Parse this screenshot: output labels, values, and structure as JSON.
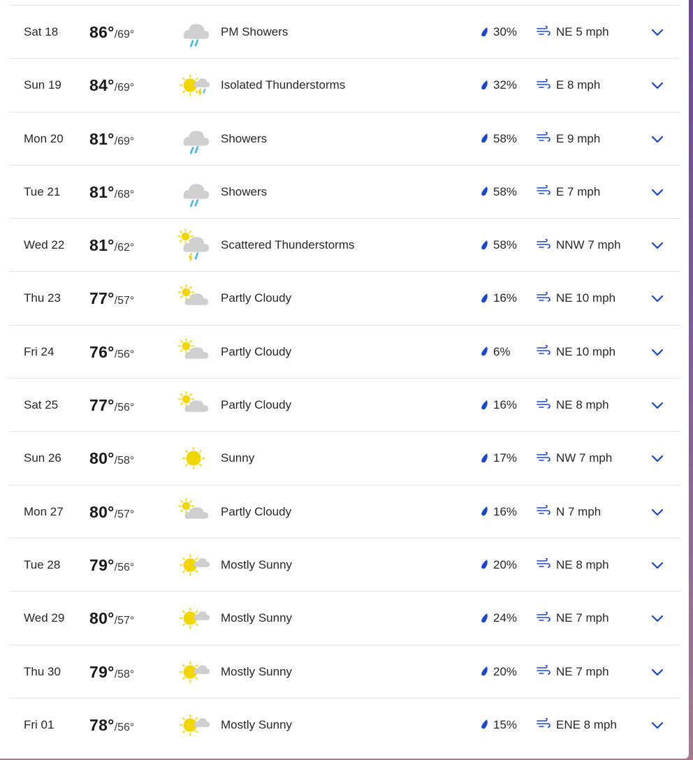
{
  "forecast": [
    {
      "day": "Sat 18",
      "high": "86°",
      "low": "/69°",
      "icon": "showers-icon",
      "condition": "PM Showers",
      "precip": "30%",
      "wind": "NE 5 mph"
    },
    {
      "day": "Sun 19",
      "high": "84°",
      "low": "/69°",
      "icon": "sun-thunder-icon",
      "condition": "Isolated Thunderstorms",
      "precip": "32%",
      "wind": "E 8 mph"
    },
    {
      "day": "Mon 20",
      "high": "81°",
      "low": "/69°",
      "icon": "showers-icon",
      "condition": "Showers",
      "precip": "58%",
      "wind": "E 9 mph"
    },
    {
      "day": "Tue 21",
      "high": "81°",
      "low": "/68°",
      "icon": "showers-icon",
      "condition": "Showers",
      "precip": "58%",
      "wind": "E 7 mph"
    },
    {
      "day": "Wed 22",
      "high": "81°",
      "low": "/62°",
      "icon": "scattered-thunderstorms-icon",
      "condition": "Scattered Thunderstorms",
      "precip": "58%",
      "wind": "NNW 7 mph"
    },
    {
      "day": "Thu 23",
      "high": "77°",
      "low": "/57°",
      "icon": "partly-cloudy-icon",
      "condition": "Partly Cloudy",
      "precip": "16%",
      "wind": "NE 10 mph"
    },
    {
      "day": "Fri 24",
      "high": "76°",
      "low": "/56°",
      "icon": "partly-cloudy-icon",
      "condition": "Partly Cloudy",
      "precip": "6%",
      "wind": "NE 10 mph"
    },
    {
      "day": "Sat 25",
      "high": "77°",
      "low": "/56°",
      "icon": "partly-cloudy-icon",
      "condition": "Partly Cloudy",
      "precip": "16%",
      "wind": "NE 8 mph"
    },
    {
      "day": "Sun 26",
      "high": "80°",
      "low": "/58°",
      "icon": "sunny-icon",
      "condition": "Sunny",
      "precip": "17%",
      "wind": "NW 7 mph"
    },
    {
      "day": "Mon 27",
      "high": "80°",
      "low": "/57°",
      "icon": "partly-cloudy-icon",
      "condition": "Partly Cloudy",
      "precip": "16%",
      "wind": "N 7 mph"
    },
    {
      "day": "Tue 28",
      "high": "79°",
      "low": "/56°",
      "icon": "mostly-sunny-icon",
      "condition": "Mostly Sunny",
      "precip": "20%",
      "wind": "NE 8 mph"
    },
    {
      "day": "Wed 29",
      "high": "80°",
      "low": "/57°",
      "icon": "mostly-sunny-icon",
      "condition": "Mostly Sunny",
      "precip": "24%",
      "wind": "NE 7 mph"
    },
    {
      "day": "Thu 30",
      "high": "79°",
      "low": "/58°",
      "icon": "mostly-sunny-icon",
      "condition": "Mostly Sunny",
      "precip": "20%",
      "wind": "NE 7 mph"
    },
    {
      "day": "Fri 01",
      "high": "78°",
      "low": "/56°",
      "icon": "mostly-sunny-icon",
      "condition": "Mostly Sunny",
      "precip": "15%",
      "wind": "ENE 8 mph"
    }
  ],
  "colors": {
    "accent": "#1a47c7",
    "sun": "#f2d600",
    "cloud": "#cfcfcf",
    "rain": "#38b6e6",
    "divider": "#e3e3e3"
  }
}
